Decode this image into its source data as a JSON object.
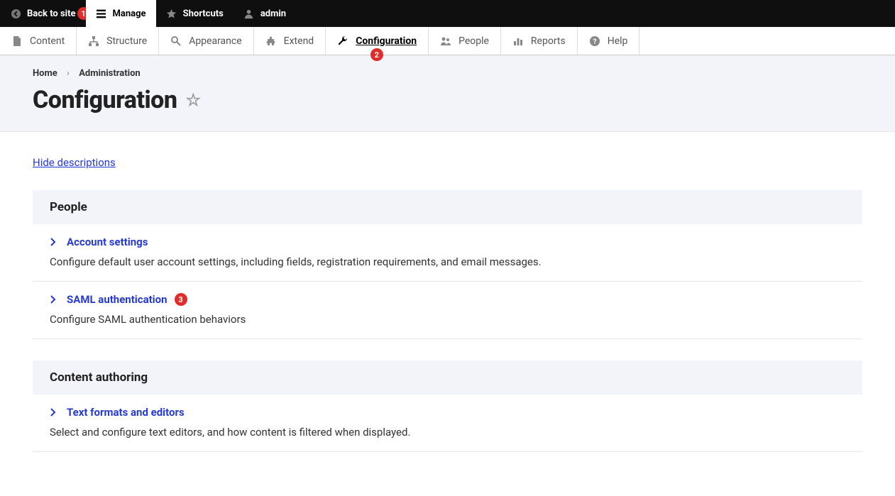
{
  "topbar": {
    "back": "Back to site",
    "manage": "Manage",
    "shortcuts": "Shortcuts",
    "admin": "admin",
    "back_badge": "1"
  },
  "adminbar": {
    "content": "Content",
    "structure": "Structure",
    "appearance": "Appearance",
    "extend": "Extend",
    "configuration": "Configuration",
    "people": "People",
    "reports": "Reports",
    "help": "Help",
    "config_badge": "2"
  },
  "breadcrumb": {
    "home": "Home",
    "admin": "Administration"
  },
  "page_title": "Configuration",
  "hide_descriptions": "Hide descriptions",
  "sections": {
    "people": {
      "title": "People",
      "items": {
        "account": {
          "label": "Account settings",
          "desc": "Configure default user account settings, including fields, registration requirements, and email messages."
        },
        "saml": {
          "label": "SAML authentication",
          "desc": "Configure SAML authentication behaviors",
          "badge": "3"
        }
      }
    },
    "content_authoring": {
      "title": "Content authoring",
      "items": {
        "text_formats": {
          "label": "Text formats and editors",
          "desc": "Select and configure text editors, and how content is filtered when displayed."
        }
      }
    }
  }
}
